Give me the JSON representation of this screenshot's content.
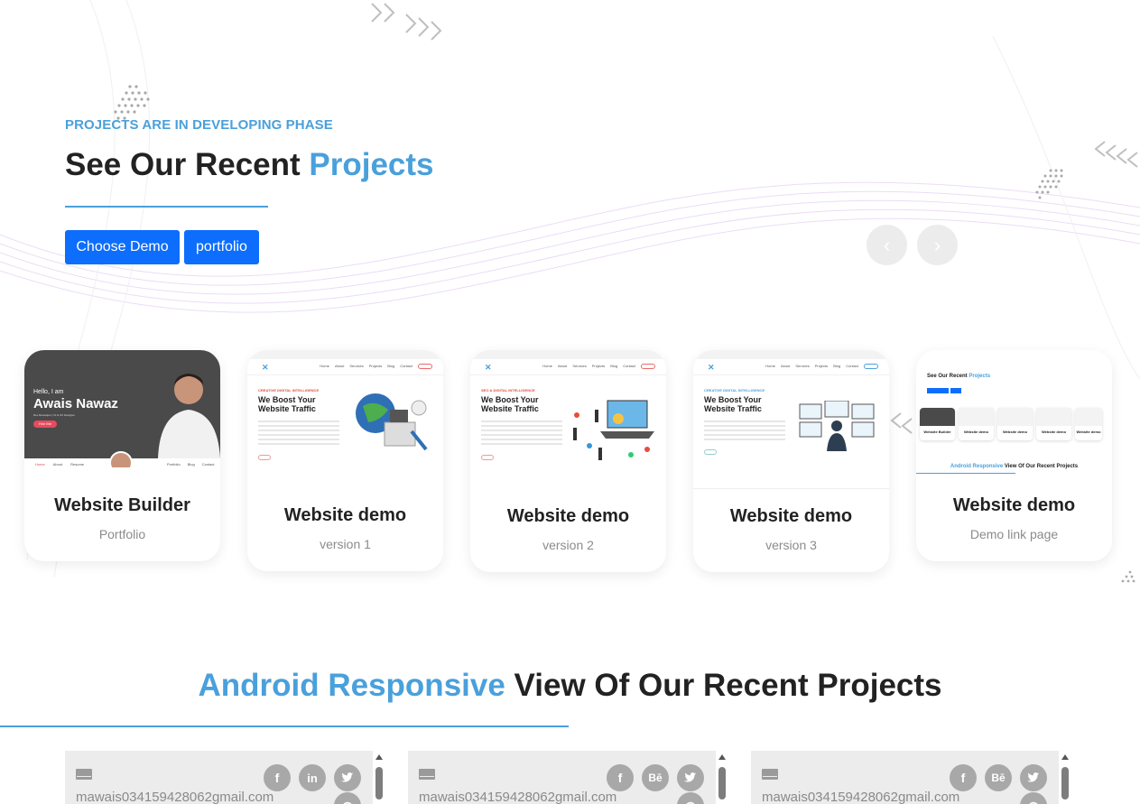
{
  "hero": {
    "eyebrow": "PROJECTS ARE IN DEVELOPING PHASE",
    "title_main": "See Our Recent ",
    "title_accent": "Projects",
    "buttons": {
      "choose_demo": "Choose Demo",
      "portfolio": "portfolio"
    },
    "nav": {
      "prev": "‹",
      "next": "›"
    }
  },
  "projects": [
    {
      "title": "Website Builder",
      "subtitle": "Portfolio",
      "thumb": {
        "greeting": "Hello, I am",
        "name": "Awais Nawaz",
        "tagline": "Dev Developer | UI & UX Designer",
        "cta": "Hire Me",
        "nav_left": [
          "Home",
          "About",
          "Resume"
        ],
        "nav_right": [
          "Portfolio",
          "Blog",
          "Contact"
        ]
      }
    },
    {
      "title": "Website demo",
      "subtitle": "version 1",
      "thumb": {
        "kicker": "CREATIVE DIGITAL INTELLIGENCE",
        "headline": "We Boost Your Website Traffic",
        "links": [
          "Home",
          "About",
          "Services",
          "Projects",
          "Blog",
          "Contact"
        ]
      }
    },
    {
      "title": "Website demo",
      "subtitle": "version 2",
      "thumb": {
        "kicker": "SEO & DIGITAL INTELLIGENCE",
        "headline": "We Boost Your Website Traffic",
        "links": [
          "Home",
          "About",
          "Services",
          "Projects",
          "Blog",
          "Contact"
        ]
      }
    },
    {
      "title": "Website demo",
      "subtitle": "version 3",
      "thumb": {
        "kicker": "CREATIVE DIGITAL INTELLIGENCE",
        "headline": "We Boost Your Website Traffic",
        "links": [
          "Home",
          "About",
          "Services",
          "Projects",
          "Blog",
          "Contact"
        ]
      }
    },
    {
      "title": "Website demo",
      "subtitle": "Demo link page",
      "thumb": {
        "title_main": "See Our Recent ",
        "title_accent": "Projects",
        "tiles": [
          "Website Builder",
          "Website demo",
          "Website demo",
          "Website demo",
          "Website demo"
        ],
        "footer_accent": "Android Responsive",
        "footer_main": " View Of Our Recent Projects"
      }
    }
  ],
  "section2": {
    "title_accent": "Android Responsive",
    "title_main": " View Of Our Recent Projects"
  },
  "contacts": [
    {
      "email": "mawais034159428062gmail.com",
      "socials": [
        {
          "icon": "facebook-icon",
          "glyph": "f"
        },
        {
          "icon": "linkedin-icon",
          "glyph": "in"
        },
        {
          "icon": "twitter-icon",
          "glyph": "🐦"
        },
        {
          "icon": "dribbble-icon",
          "glyph": "◍"
        }
      ]
    },
    {
      "email": "mawais034159428062gmail.com",
      "socials": [
        {
          "icon": "facebook-icon",
          "glyph": "f"
        },
        {
          "icon": "behance-icon",
          "glyph": "Bē"
        },
        {
          "icon": "twitter-icon",
          "glyph": "🐦"
        },
        {
          "icon": "dribbble-icon",
          "glyph": "◍"
        }
      ]
    },
    {
      "email": "mawais034159428062gmail.com",
      "socials": [
        {
          "icon": "facebook-icon",
          "glyph": "f"
        },
        {
          "icon": "behance-icon",
          "glyph": "Bē"
        },
        {
          "icon": "twitter-icon",
          "glyph": "🐦"
        },
        {
          "icon": "dribbble-icon",
          "glyph": "◍"
        }
      ]
    }
  ],
  "colors": {
    "accent": "#4aa0db",
    "button": "#0d6efd",
    "text": "#222222",
    "muted": "#8b8b8b"
  }
}
